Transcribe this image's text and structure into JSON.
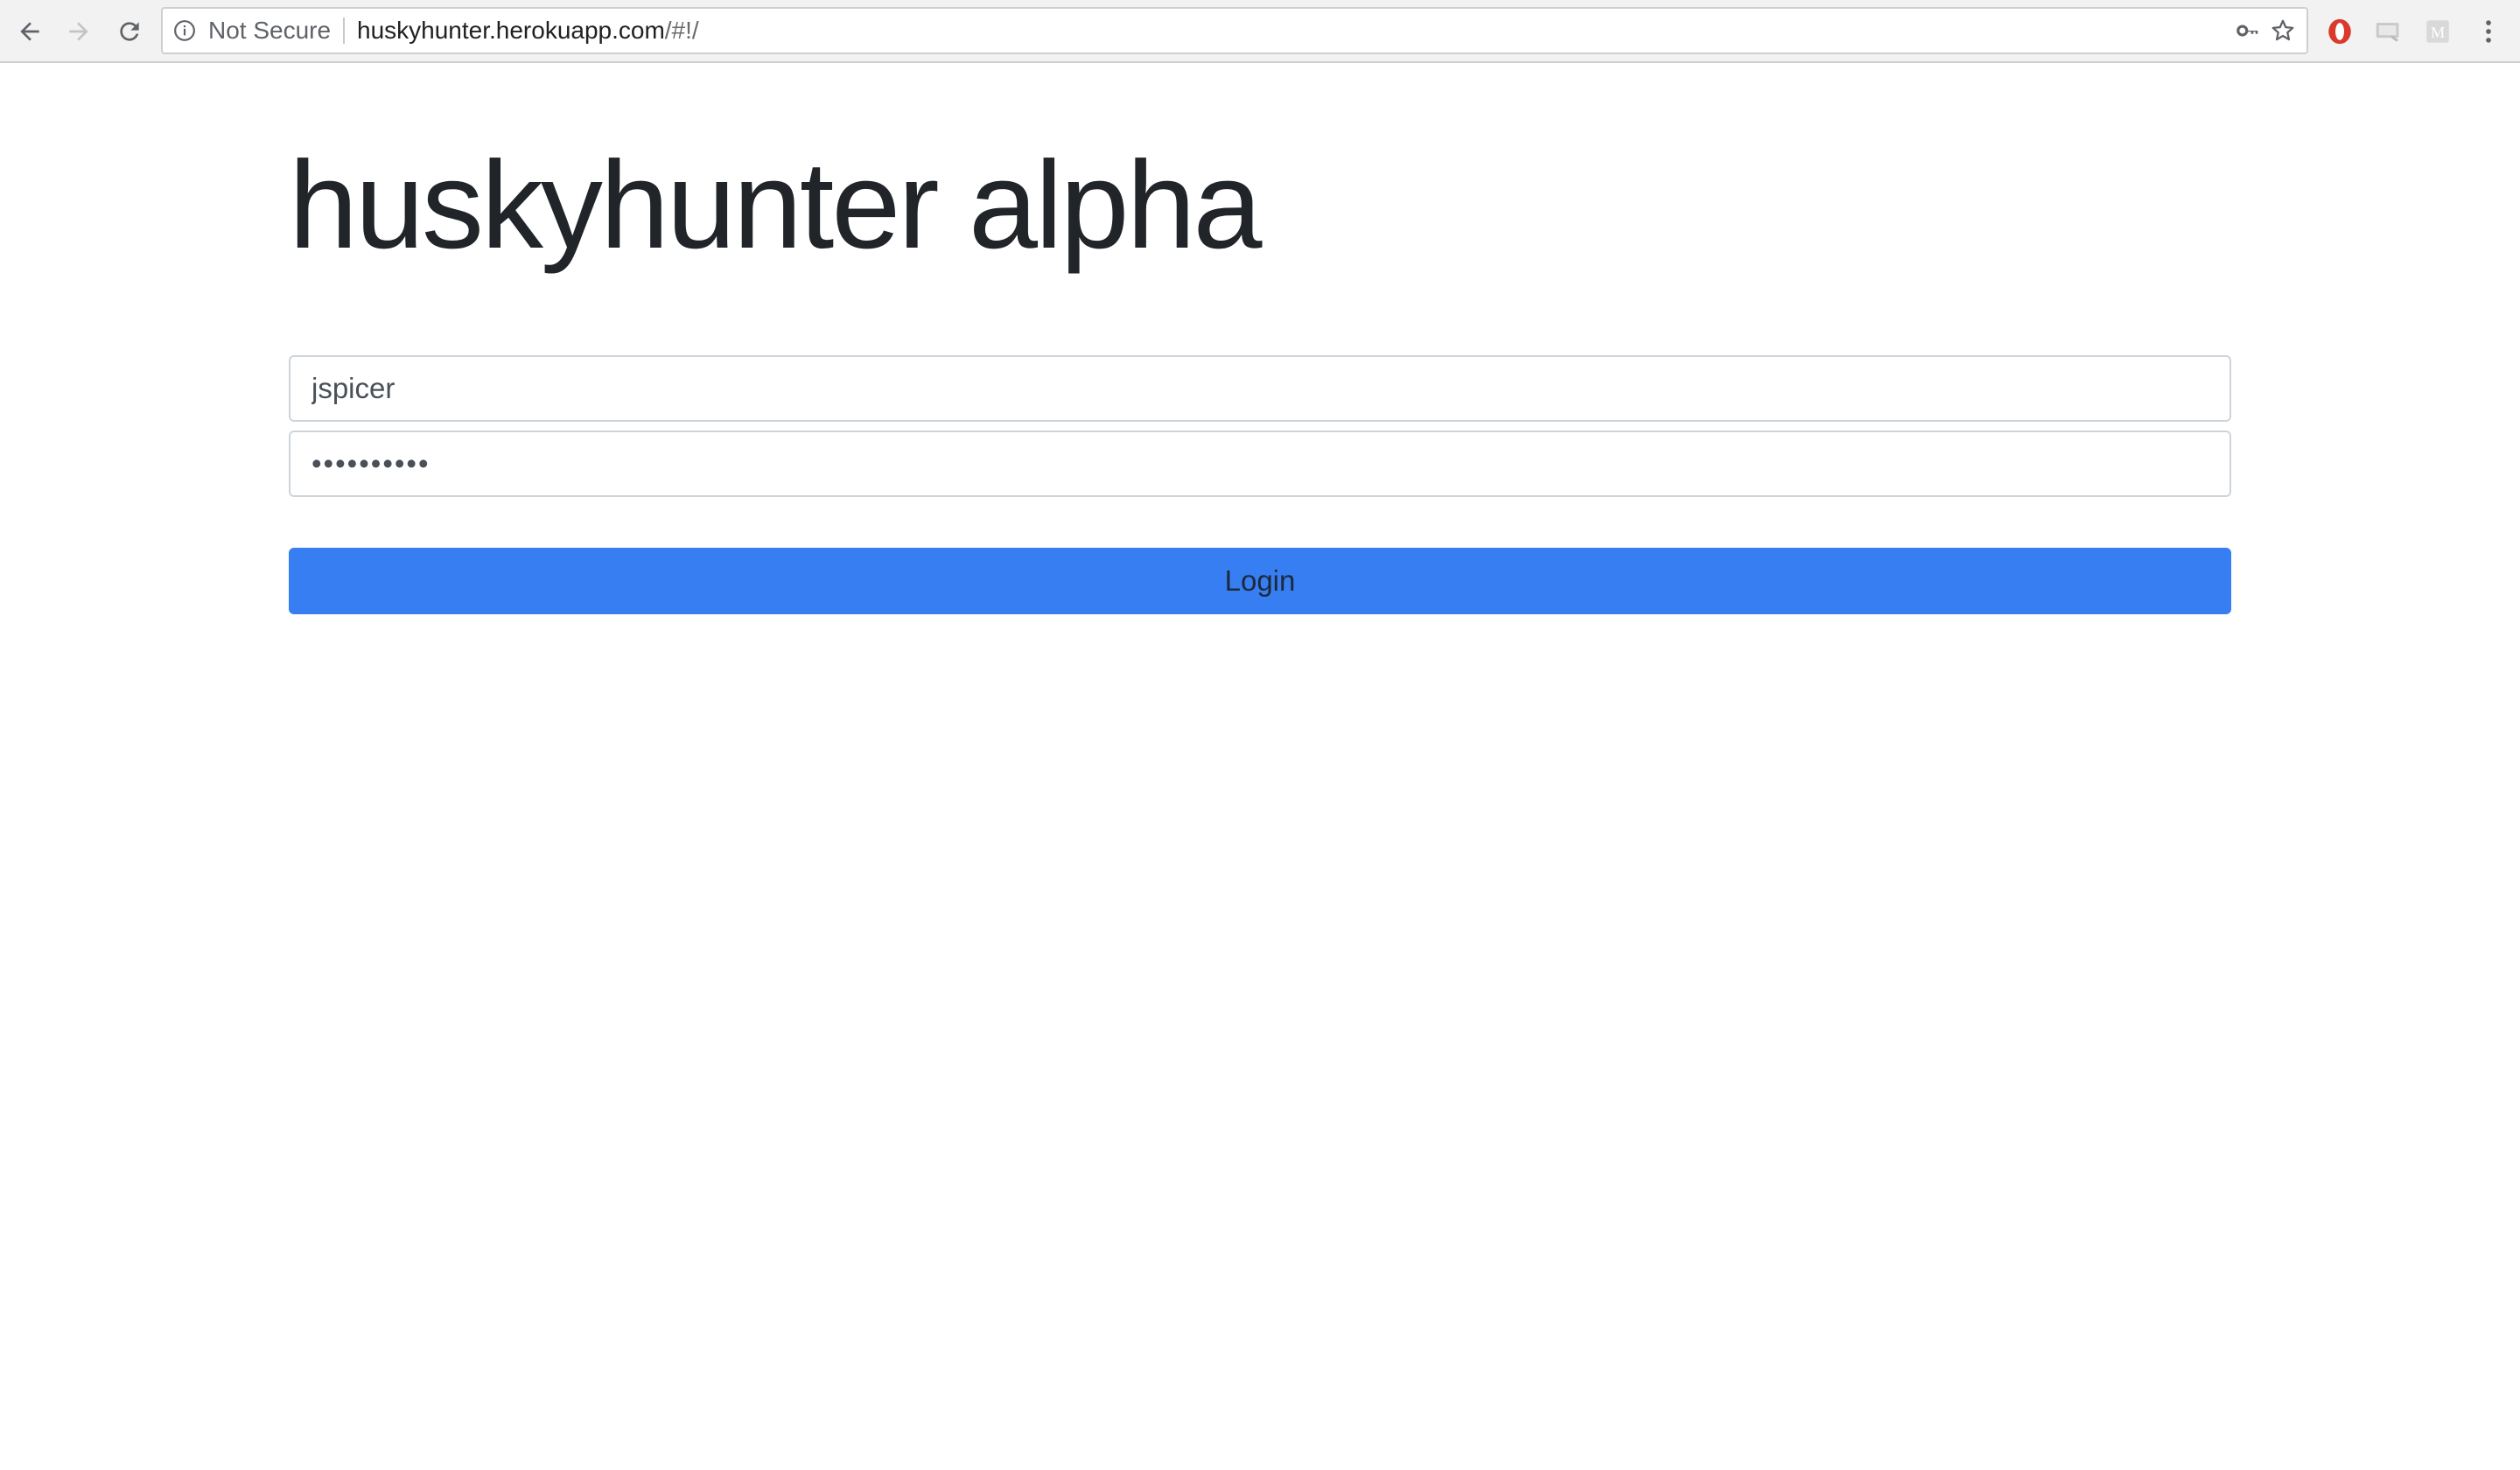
{
  "browser": {
    "security_label": "Not Secure",
    "url_host": "huskyhunter.herokuapp.com",
    "url_path": "/#!/",
    "icons": [
      "back-icon",
      "forward-icon",
      "reload-icon",
      "info-icon",
      "key-icon",
      "star-icon",
      "opera-extension-icon",
      "screen-extension-icon",
      "m-extension-icon",
      "menu-icon"
    ]
  },
  "page": {
    "title": "huskyhunter alpha",
    "username_value": "jspicer",
    "password_value": "••••••••••",
    "login_label": "Login"
  },
  "colors": {
    "primary": "#377ef3",
    "text": "#212529"
  }
}
